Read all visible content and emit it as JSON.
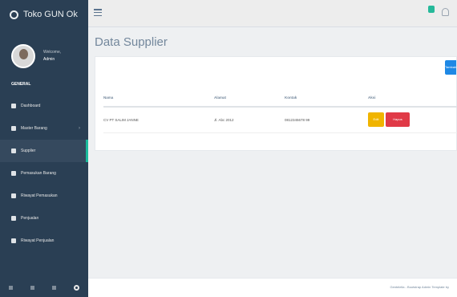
{
  "brand": {
    "title": "Toko GUN Ok"
  },
  "profile": {
    "welcome": "Welcome,",
    "name": "Admin"
  },
  "sidebar": {
    "section": "GENERAL",
    "items": [
      {
        "label": "Dashboard",
        "icon": "dashboard-icon",
        "active": false
      },
      {
        "label": "Master Barang",
        "icon": "desktop-icon",
        "active": false,
        "has_chevron": true
      },
      {
        "label": "Supplier",
        "icon": "truck-icon",
        "active": true
      },
      {
        "label": "Pemasukan Barang",
        "icon": "monitor-icon",
        "active": false
      },
      {
        "label": "Riwayat Pemasukan",
        "icon": "history-icon",
        "active": false
      },
      {
        "label": "Penjualan",
        "icon": "chart-icon",
        "active": false
      },
      {
        "label": "Riwayat Penjualan",
        "icon": "clock-icon",
        "active": false
      }
    ],
    "chevron": "›"
  },
  "page": {
    "title": "Data Supplier"
  },
  "panel": {
    "add_button": "Tambah"
  },
  "table": {
    "headers": [
      "Nama",
      "Alamat",
      "Kontak",
      "Aksi"
    ],
    "rows": [
      {
        "nama": "CV PT SALIM JANNE",
        "alamat": "Jl. Abc 2012",
        "kontak": "0812345678 99"
      }
    ],
    "edit_label": "Edit",
    "delete_label": "Hapus"
  },
  "footer": {
    "text": "Gentelella - Bootstrap Admin Template by"
  },
  "colors": {
    "sidebar": "#2a3f54",
    "accent": "#1abb9c",
    "edit": "#f0b400",
    "delete": "#e03a47",
    "primary": "#1e88e5"
  }
}
